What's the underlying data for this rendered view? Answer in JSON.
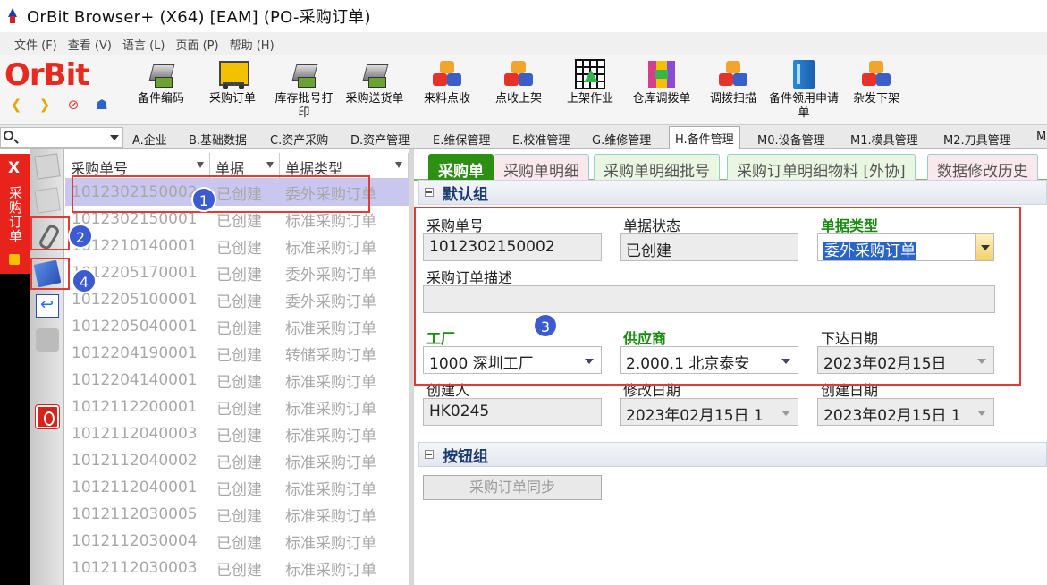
{
  "window": {
    "title": "OrBit Browser+ (X64) [EAM] (PO-采购订单)"
  },
  "menu": [
    "文件 (F)",
    "查看 (V)",
    "语言 (L)",
    "页面 (P)",
    "帮助 (H)"
  ],
  "logo": {
    "text": "OrBit"
  },
  "toolbar": [
    {
      "label": "备件编码",
      "icon": "scanner-icon"
    },
    {
      "label": "采购订单",
      "icon": "cart-icon"
    },
    {
      "label": "库存批号打印",
      "icon": "scanner-icon"
    },
    {
      "label": "采购送货单",
      "icon": "scanner-icon"
    },
    {
      "label": "来料点收",
      "icon": "cubes-icon"
    },
    {
      "label": "点收上架",
      "icon": "cubes-icon"
    },
    {
      "label": "上架作业",
      "icon": "grid-arrow-icon"
    },
    {
      "label": "仓库调拨单",
      "icon": "transfer-icon"
    },
    {
      "label": "调拨扫描",
      "icon": "cubes-icon"
    },
    {
      "label": "备件领用申请单",
      "icon": "book-icon"
    },
    {
      "label": "杂发下架",
      "icon": "cubes-icon"
    }
  ],
  "nav_tabs": [
    "A.企业",
    "B.基础数据",
    "C.资产采购",
    "D.资产管理",
    "E.维保管理",
    "E.校准管理",
    "G.维修管理",
    "H.备件管理",
    "M0.设备管理",
    "M1.模具管理",
    "M2.刀具管理",
    "M"
  ],
  "vertical_tab": {
    "label": "采购订单",
    "close": "X"
  },
  "list": {
    "headers": [
      "采购单号",
      "单据",
      "单据类型"
    ],
    "rows": [
      [
        "1012302150002",
        "已创建",
        "委外采购订单"
      ],
      [
        "1012302150001",
        "已创建",
        "标准采购订单"
      ],
      [
        "1012210140001",
        "已创建",
        "标准采购订单"
      ],
      [
        "1012205170001",
        "已创建",
        "委外采购订单"
      ],
      [
        "1012205100001",
        "已创建",
        "委外采购订单"
      ],
      [
        "1012205040001",
        "已创建",
        "标准采购订单"
      ],
      [
        "1012204190001",
        "已创建",
        "转储采购订单"
      ],
      [
        "1012204140001",
        "已创建",
        "标准采购订单"
      ],
      [
        "1012112200001",
        "已创建",
        "标准采购订单"
      ],
      [
        "1012112040003",
        "已创建",
        "标准采购订单"
      ],
      [
        "1012112040002",
        "已创建",
        "标准采购订单"
      ],
      [
        "1012112040001",
        "已创建",
        "标准采购订单"
      ],
      [
        "1012112030005",
        "已创建",
        "标准采购订单"
      ],
      [
        "1012112030004",
        "已创建",
        "标准采购订单"
      ],
      [
        "1012112030003",
        "已创建",
        "标准采购订单"
      ]
    ]
  },
  "detail_tabs": [
    "采购单",
    "采购单明细",
    "采购单明细批号",
    "采购订单明细物料 [外协]",
    "数据修改历史"
  ],
  "default_group": {
    "title": "默认组",
    "po_number_label": "采购单号",
    "po_number": "1012302150002",
    "status_label": "单据状态",
    "status": "已创建",
    "type_label": "单据类型",
    "type": "委外采购订单",
    "desc_label": "采购订单描述",
    "desc": "",
    "factory_label": "工厂",
    "factory": "1000 深圳工厂",
    "supplier_label": "供应商",
    "supplier": "2.000.1 北京泰安",
    "issue_date_label": "下达日期",
    "issue_date": "2023年02月15日",
    "creator_label": "创建人",
    "creator": "HK0245",
    "modified_label": "修改日期",
    "modified": "2023年02月15日 1",
    "created_label": "创建日期",
    "created": "2023年02月15日 1"
  },
  "button_group": {
    "title": "按钮组",
    "sync_label": "采购订单同步"
  },
  "annotations": [
    "1",
    "2",
    "3",
    "4"
  ],
  "colors": {
    "accent_red": "#e8231c",
    "tab_green": "#2d8f14",
    "selection": "#c9c6f0"
  }
}
